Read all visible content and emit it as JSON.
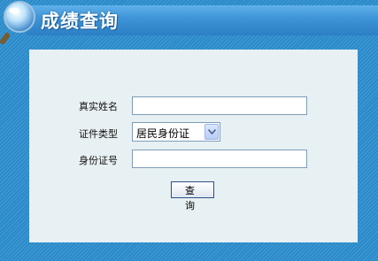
{
  "header": {
    "title": "成绩查询"
  },
  "form": {
    "name_label": "真实姓名",
    "name_value": "",
    "id_type_label": "证件类型",
    "id_type_selected": "居民身份证",
    "id_number_label": "身份证号",
    "id_number_value": "",
    "submit_label": "查 询"
  },
  "colors": {
    "background": "#2d8fd0",
    "panel": "#e7f0f2",
    "title_text": "#ffffff"
  },
  "icons": {
    "logo": "magnifier-icon"
  }
}
